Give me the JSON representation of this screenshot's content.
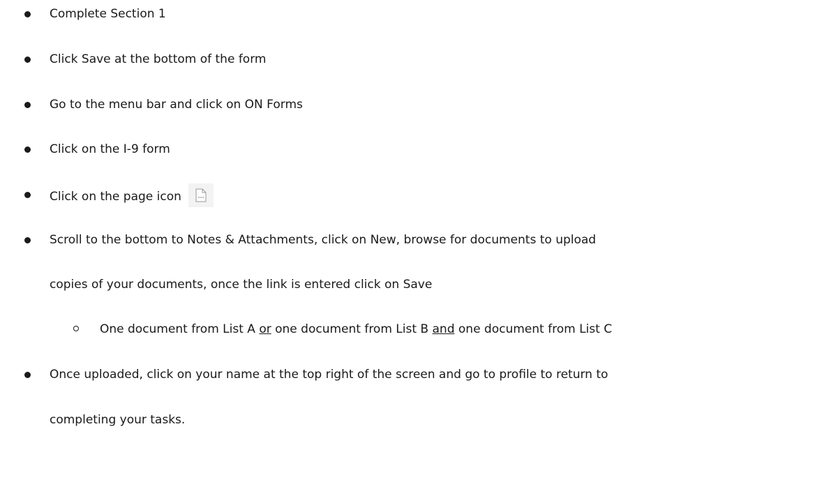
{
  "items": [
    {
      "text": "Complete Section 1"
    },
    {
      "text": "Click Save at the bottom of the form"
    },
    {
      "text": "Go to the menu bar and click on ON Forms"
    },
    {
      "text": "Click on the I-9 form"
    },
    {
      "text": "Click on the page icon",
      "icon": "page-icon"
    },
    {
      "text": "Scroll to the bottom to Notes & Attachments, click on New, browse for documents to upload",
      "continuation": "copies of your documents, once the link is entered click on Save"
    },
    {
      "sub": true,
      "parts": [
        "One document from List A ",
        "or",
        " one document from List B ",
        "and",
        " one document from List C"
      ]
    },
    {
      "text": "Once uploaded, click on your name at the top right of the screen and go to profile to return to",
      "continuation": "completing your tasks."
    }
  ]
}
